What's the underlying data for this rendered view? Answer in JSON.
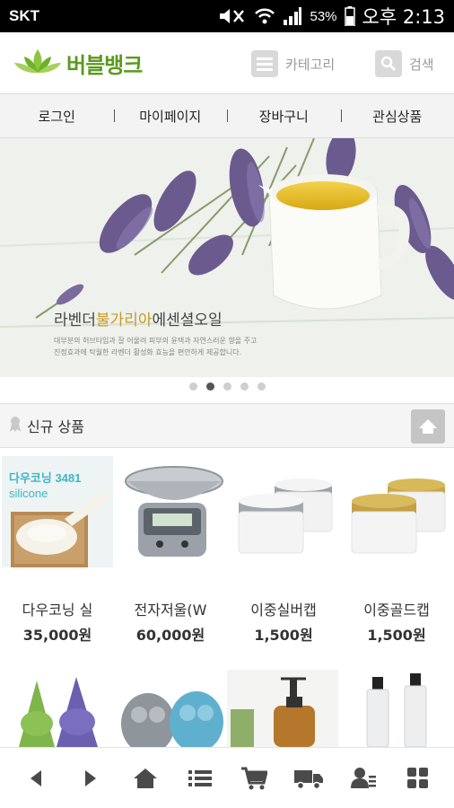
{
  "status_bar": {
    "carrier": "SKT",
    "battery": "53%",
    "time": "오후 2:13"
  },
  "header": {
    "app_name": "버블뱅크",
    "category_label": "카테고리",
    "search_label": "검색"
  },
  "top_nav": [
    "로그인",
    "마이페이지",
    "장바구니",
    "관심상품"
  ],
  "banner": {
    "title_prefix": "라벤더",
    "title_highlight": "불가리아",
    "title_suffix": "에센셜오일",
    "description": "대부분의 허브타입과 잘 어울려 피부의 윤택과 자연스러운 향을 주고 진정효과에 탁월한 라벤더 활성화 효능을 편안하게 제공합니다.",
    "slide_count": 5,
    "active_slide": 2
  },
  "new_products": {
    "title": "신규 상품",
    "items": [
      {
        "name": "다우코닝 실",
        "price": "35,000원",
        "thumb_text_1": "다우코닝 3481",
        "thumb_text_2": "silicone"
      },
      {
        "name": "전자저울(W",
        "price": "60,000원"
      },
      {
        "name": "이중실버캡",
        "price": "1,500원"
      },
      {
        "name": "이중골드캡",
        "price": "1,500원"
      }
    ]
  },
  "colors": {
    "brand_green": "#5b9a1d",
    "dot_active": "#555555",
    "dot_inactive": "#cfcfcf",
    "silicone_label": "#3fb4c8"
  },
  "bottom_bar": [
    "back-icon",
    "forward-icon",
    "home-icon",
    "list-icon",
    "cart-icon",
    "delivery-icon",
    "member-icon",
    "grid-icon"
  ]
}
